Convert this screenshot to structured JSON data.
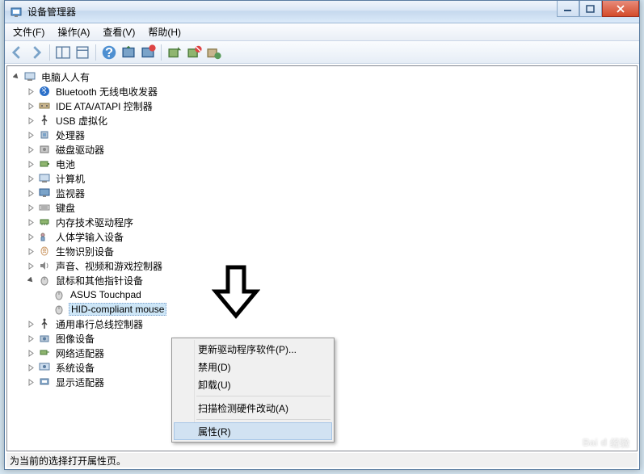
{
  "window": {
    "title": "设备管理器"
  },
  "menu": {
    "file": "文件(F)",
    "action": "操作(A)",
    "view": "查看(V)",
    "help": "帮助(H)"
  },
  "tree": {
    "root": "电脑人人有",
    "bluetooth": "Bluetooth 无线电收发器",
    "ide": "IDE ATA/ATAPI 控制器",
    "usb_virt": "USB 虚拟化",
    "cpu": "处理器",
    "disk": "磁盘驱动器",
    "battery": "电池",
    "computer": "计算机",
    "monitor": "监视器",
    "keyboard": "键盘",
    "memtech": "内存技术驱动程序",
    "hid": "人体学输入设备",
    "biometric": "生物识别设备",
    "sound": "声音、视频和游戏控制器",
    "mouse_cat": "鼠标和其他指针设备",
    "mouse_asus": "ASUS Touchpad",
    "mouse_hid": "HID-compliant mouse",
    "usb_bus": "通用串行总线控制器",
    "imaging": "图像设备",
    "network": "网络适配器",
    "system": "系统设备",
    "display": "显示适配器"
  },
  "context": {
    "update": "更新驱动程序软件(P)...",
    "disable": "禁用(D)",
    "uninstall": "卸载(U)",
    "scan": "扫描检测硬件改动(A)",
    "properties": "属性(R)"
  },
  "status": "为当前的选择打开属性页。",
  "watermark": "经验"
}
